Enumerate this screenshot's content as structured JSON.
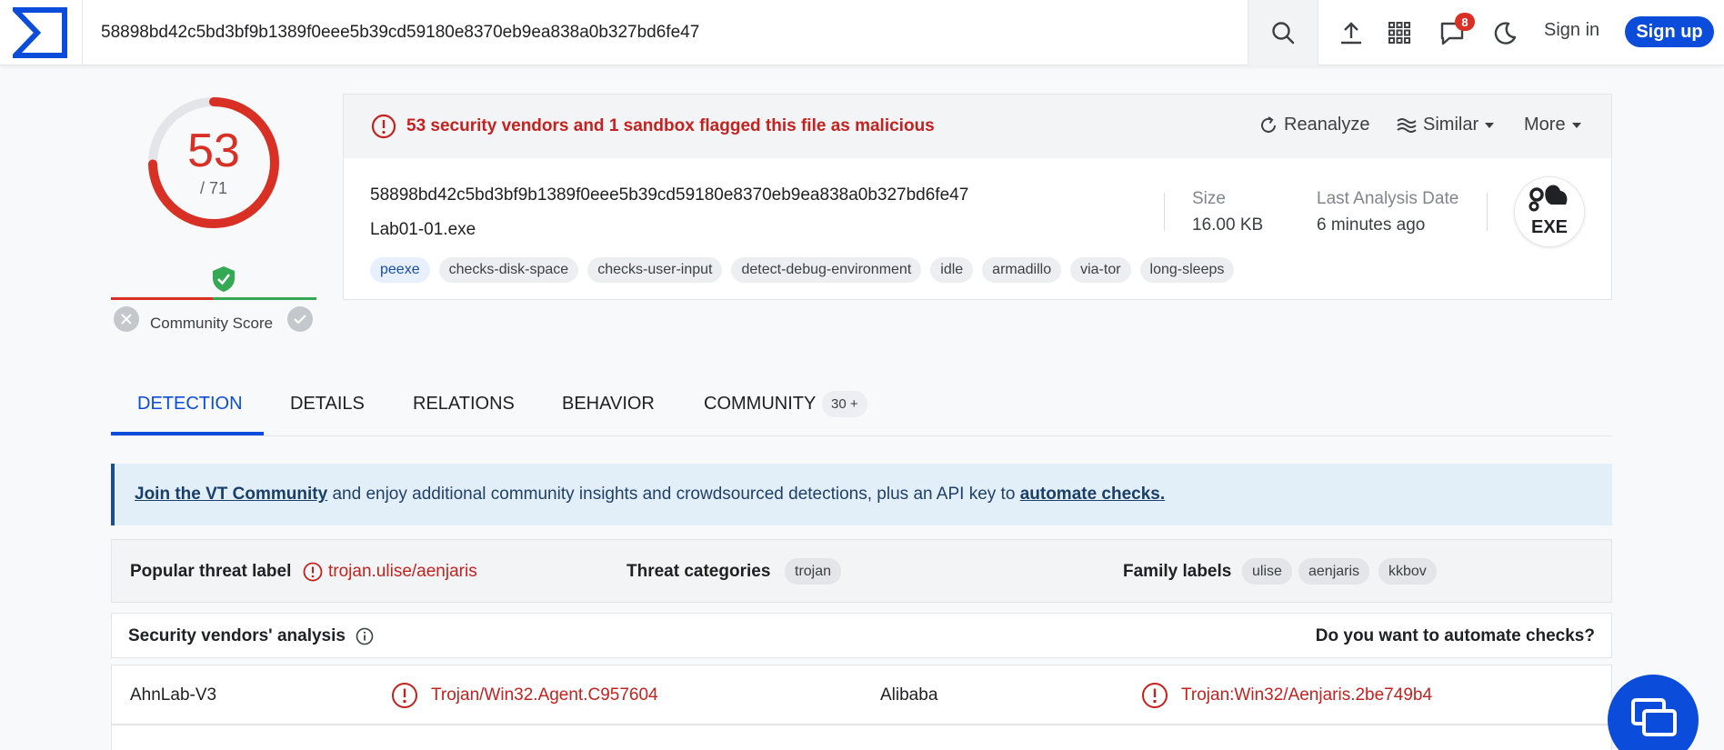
{
  "header": {
    "search_value": "58898bd42c5bd3bf9b1389f0eee5b39cd59180e8370eb9ea838a0b327bd6fe47",
    "notification_count": "8",
    "signin_label": "Sign in",
    "signup_label": "Sign up"
  },
  "score": {
    "detections": "53",
    "total": "/ 71",
    "detection_fraction": 0.746,
    "community_label": "Community Score"
  },
  "summary": {
    "alert": "53 security vendors and 1 sandbox flagged this file as malicious",
    "reanalyze": "Reanalyze",
    "similar": "Similar",
    "more": "More",
    "hash": "58898bd42c5bd3bf9b1389f0eee5b39cd59180e8370eb9ea838a0b327bd6fe47",
    "filename": "Lab01-01.exe",
    "tags": [
      "peexe",
      "checks-disk-space",
      "checks-user-input",
      "detect-debug-environment",
      "idle",
      "armadillo",
      "via-tor",
      "long-sleeps"
    ],
    "size_label": "Size",
    "size_value": "16.00 KB",
    "date_label": "Last Analysis Date",
    "date_value": "6 minutes ago",
    "file_type": "EXE"
  },
  "tabs": {
    "detection": "DETECTION",
    "details": "DETAILS",
    "relations": "RELATIONS",
    "behavior": "BEHAVIOR",
    "community": "COMMUNITY",
    "community_badge": "30 +"
  },
  "banner": {
    "link1": "Join the VT Community",
    "middle": " and enjoy additional community insights and crowdsourced detections, plus an API key to ",
    "link2": "automate checks."
  },
  "threat": {
    "popular_label": "Popular threat label",
    "popular_value": "trojan.ulise/aenjaris",
    "categories_label": "Threat categories",
    "categories": [
      "trojan"
    ],
    "family_label": "Family labels",
    "families": [
      "ulise",
      "aenjaris",
      "kkbov"
    ]
  },
  "vendors": {
    "title": "Security vendors' analysis",
    "automate": "Do you want to automate checks?",
    "rows": [
      {
        "left_name": "AhnLab-V3",
        "left_result": "Trojan/Win32.Agent.C957604",
        "right_name": "Alibaba",
        "right_result": "Trojan:Win32/Aenjaris.2be749b4"
      }
    ]
  },
  "colors": {
    "brand_blue": "#0b4dda",
    "malicious_red": "#d93025",
    "clean_green": "#34a853"
  }
}
